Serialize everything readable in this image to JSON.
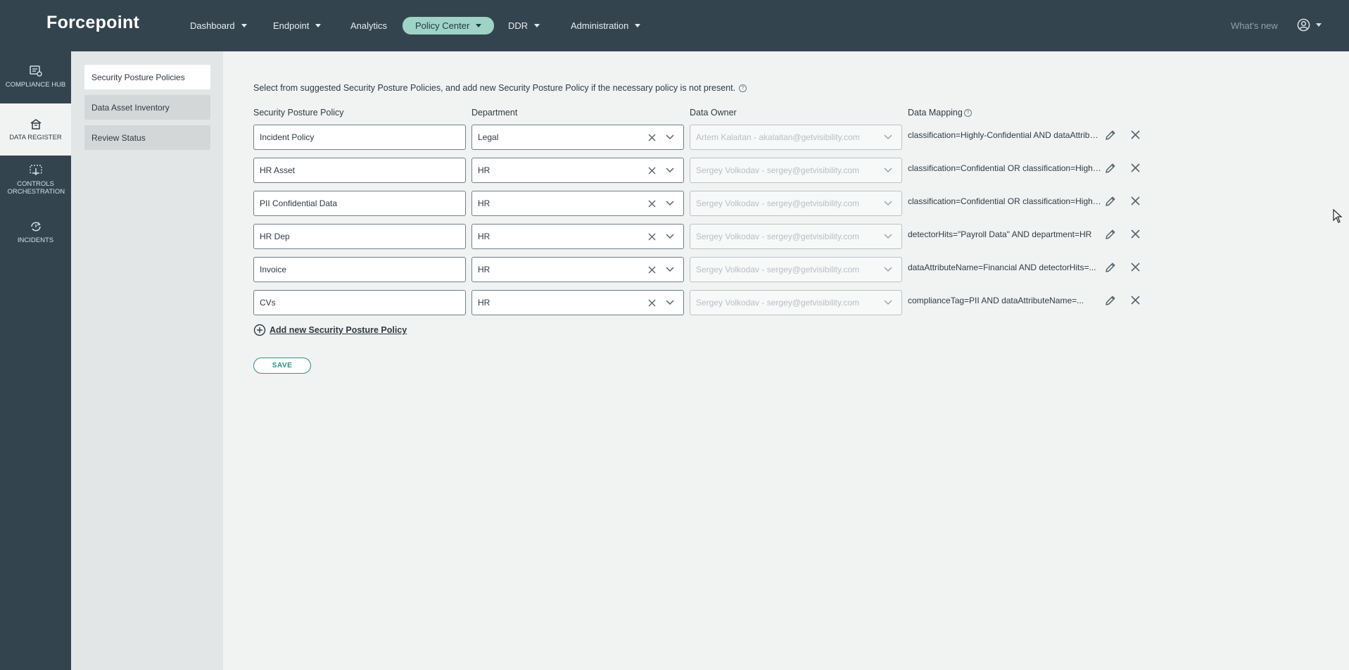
{
  "app": {
    "logo_text": "Forcepoint",
    "accent": "#9fd3c7",
    "bar_color": "#34444f"
  },
  "nav": {
    "items": [
      {
        "label": "Dashboard",
        "dropdown": true
      },
      {
        "label": "Endpoint",
        "dropdown": true
      },
      {
        "label": "Analytics",
        "dropdown": false
      },
      {
        "label": "Policy Center",
        "dropdown": true,
        "active": true
      },
      {
        "label": "DDR",
        "dropdown": true
      },
      {
        "label": "Administration",
        "dropdown": true
      }
    ],
    "whats_new": "What's new",
    "user_icon": "user-circle-icon"
  },
  "rail": {
    "items": [
      {
        "label": "COMPLIANCE HUB",
        "icon": "compliance-hub-icon"
      },
      {
        "label": "DATA REGISTER",
        "icon": "data-register-icon",
        "active": true
      },
      {
        "label": "CONTROLS ORCHESTRATION",
        "icon": "controls-orchestration-icon"
      },
      {
        "label": "INCIDENTS",
        "icon": "incidents-icon"
      }
    ]
  },
  "subnav": {
    "items": [
      {
        "label": "Security Posture Policies",
        "active": true
      },
      {
        "label": "Data Asset Inventory"
      },
      {
        "label": "Review Status"
      }
    ]
  },
  "main": {
    "intro": "Select from suggested Security Posture Policies, and add new Security Posture Policy if the necessary policy is not present.",
    "columns": {
      "policy": "Security Posture Policy",
      "department": "Department",
      "owner": "Data Owner",
      "mapping": "Data Mapping"
    },
    "rows": [
      {
        "policy": "Incident Policy",
        "department": "Legal",
        "owner": "Artem Kalaitan - akalaitan@getvisibility.com",
        "mapping": "classification=Highly-Confidential AND dataAttributeName=..."
      },
      {
        "policy": "HR Asset",
        "department": "HR",
        "owner": "Sergey Volkodav - sergey@getvisibility.com",
        "mapping": "classification=Confidential OR classification=Highly-Confidential"
      },
      {
        "policy": "PII Confidential Data",
        "department": "HR",
        "owner": "Sergey Volkodav - sergey@getvisibility.com",
        "mapping": "classification=Confidential OR classification=Highly-Confidential"
      },
      {
        "policy": "HR Dep",
        "department": "HR",
        "owner": "Sergey Volkodav - sergey@getvisibility.com",
        "mapping": "detectorHits=\"Payroll Data\" AND department=HR"
      },
      {
        "policy": "Invoice",
        "department": "HR",
        "owner": "Sergey Volkodav - sergey@getvisibility.com",
        "mapping": "dataAttributeName=Financial AND detectorHits=..."
      },
      {
        "policy": "CVs",
        "department": "HR",
        "owner": "Sergey Volkodav - sergey@getvisibility.com",
        "mapping": "complianceTag=PII AND dataAttributeName=..."
      }
    ],
    "add_new_label": "Add new Security Posture Policy",
    "save_label": "SAVE"
  }
}
